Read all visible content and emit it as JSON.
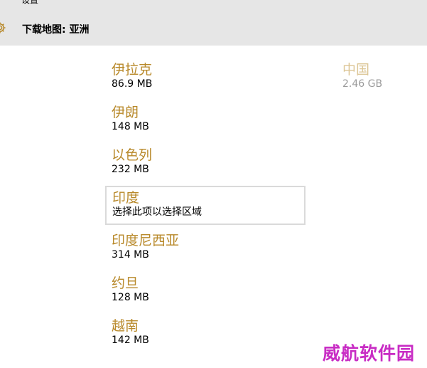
{
  "header": {
    "app_title": "设置",
    "page_title": "下载地图: 亚洲",
    "icon": "gear-icon"
  },
  "regions": [
    {
      "name": "伊拉克",
      "size": "86.9 MB"
    },
    {
      "name": "伊朗",
      "size": "148 MB"
    },
    {
      "name": "以色列",
      "size": "232 MB"
    },
    {
      "name": "印度",
      "size": "选择此项以选择区域",
      "selected": true
    },
    {
      "name": "印度尼西亚",
      "size": "314 MB"
    },
    {
      "name": "约旦",
      "size": "128 MB"
    },
    {
      "name": "越南",
      "size": "142 MB"
    },
    {
      "name": "中国",
      "size": "2.46 GB",
      "dimmed": true
    }
  ],
  "watermark": "威航软件园",
  "colors": {
    "header_bg": "#e6e6e6",
    "accent": "#b8892a",
    "accent_dimmed": "#dcc696",
    "selection_border": "#dadada",
    "watermark": "#c82cc4"
  }
}
